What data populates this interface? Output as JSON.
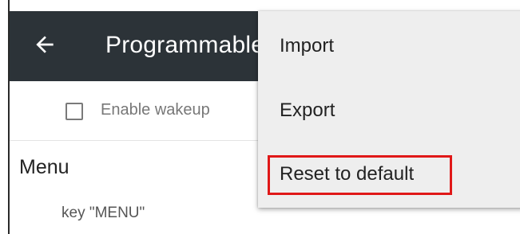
{
  "app_bar": {
    "title": "Programmable keys",
    "back_icon": "arrow-left-icon",
    "background": "#2c3338"
  },
  "settings": {
    "enable_wakeup_label": "Enable wakeup",
    "enable_wakeup_checked": false,
    "section_title": "Menu",
    "section_subtitle": "key \"MENU\""
  },
  "overflow_menu": {
    "items": [
      {
        "label": "Import"
      },
      {
        "label": "Export"
      },
      {
        "label": "Reset to default"
      }
    ],
    "highlighted_item_color": "#e01818"
  }
}
